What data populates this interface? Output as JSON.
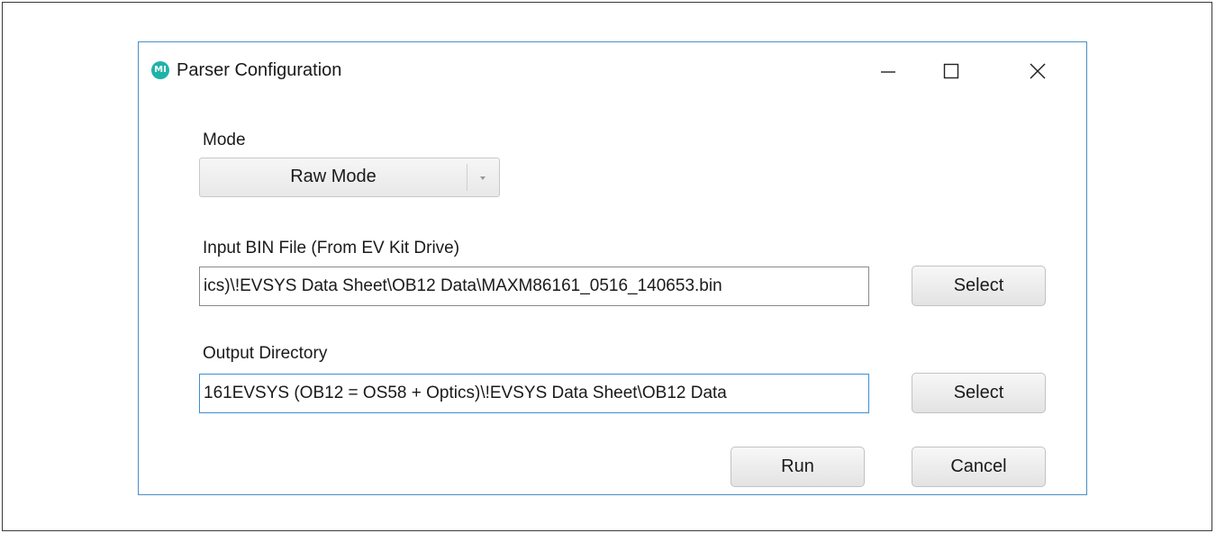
{
  "window": {
    "title": "Parser Configuration",
    "logo_text": "MI",
    "logo_color": "#1fb3a8",
    "controls": {
      "minimize": "minimize-icon",
      "maximize": "maximize-icon",
      "close": "close-icon"
    }
  },
  "mode": {
    "label": "Mode",
    "selected": "Raw Mode"
  },
  "input_file": {
    "label": "Input BIN File (From EV Kit Drive)",
    "value": "ics)\\!EVSYS Data Sheet\\OB12 Data\\MAXM86161_0516_140653.bin",
    "select_label": "Select"
  },
  "output_dir": {
    "label": "Output Directory",
    "value": "161EVSYS (OB12 = OS58 + Optics)\\!EVSYS Data Sheet\\OB12 Data",
    "select_label": "Select"
  },
  "actions": {
    "run_label": "Run",
    "cancel_label": "Cancel"
  },
  "colors": {
    "window_border": "#4a8fc4",
    "focus_border": "#3d8fd6"
  }
}
